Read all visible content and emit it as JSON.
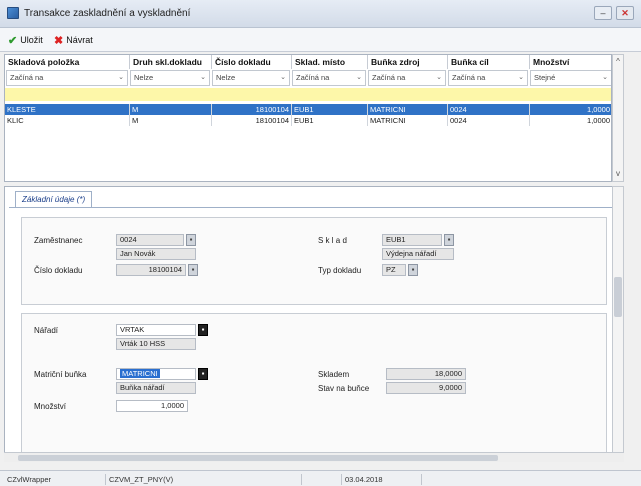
{
  "window": {
    "title": "Transakce zaskladnění a vyskladnění",
    "min_label": "–",
    "close_label": "✕"
  },
  "toolbar": {
    "save_label": "Uložit",
    "back_label": "Návrat"
  },
  "grid": {
    "columns": [
      "Skladová položka",
      "Druh skl.dokladu",
      "Číslo dokladu",
      "Sklad. místo",
      "Buňka zdroj",
      "Buňka cíl",
      "Množství"
    ],
    "filters": [
      "Začíná na",
      "Nelze",
      "Nelze",
      "Začíná na",
      "Začíná na",
      "Začíná na",
      "Stejné"
    ],
    "rows": [
      [
        "KLESTE",
        "M",
        "18100104",
        "EUB1",
        "MATRICNI",
        "0024",
        "1,0000"
      ],
      [
        "KLIC",
        "M",
        "18100104",
        "EUB1",
        "MATRICNI",
        "0024",
        "1,0000"
      ]
    ]
  },
  "detail": {
    "tab_label": "Základní údaje  (*)",
    "employee": {
      "label": "Zaměstnanec",
      "code": "0024",
      "name": "Jan Novák"
    },
    "doc_number": {
      "label": "Číslo dokladu",
      "value": "18100104"
    },
    "warehouse": {
      "label": "S k l a d",
      "code": "EUB1",
      "name": "Výdejna nářadí"
    },
    "doc_type": {
      "label": "Typ dokladu",
      "value": "PZ"
    },
    "tool": {
      "label": "Nářadí",
      "code": "VRTAK",
      "name": "Vrták 10 HSS"
    },
    "matrix_cell": {
      "label": "Matriční buňka",
      "code": "MATRICNI",
      "name": "Buňka nářadí"
    },
    "quantity": {
      "label": "Množství",
      "value": "1,0000"
    },
    "in_stock": {
      "label": "Skladem",
      "value": "18,0000"
    },
    "cell_state": {
      "label": "Stav na buňce",
      "value": "9,0000"
    }
  },
  "status": {
    "wrapper": "CZvlWrapper",
    "form": "CZVM_ZT_PNY(V)",
    "date": "03.04.2018"
  },
  "colors": {
    "selected_row": "#2f72c6",
    "filter_row": "#fdf7a9",
    "save_check": "#2e9a2e",
    "back_x": "#d22222"
  },
  "icons": [
    "app-icon",
    "check-icon",
    "x-icon",
    "dropdown-icon",
    "picker-icon"
  ]
}
